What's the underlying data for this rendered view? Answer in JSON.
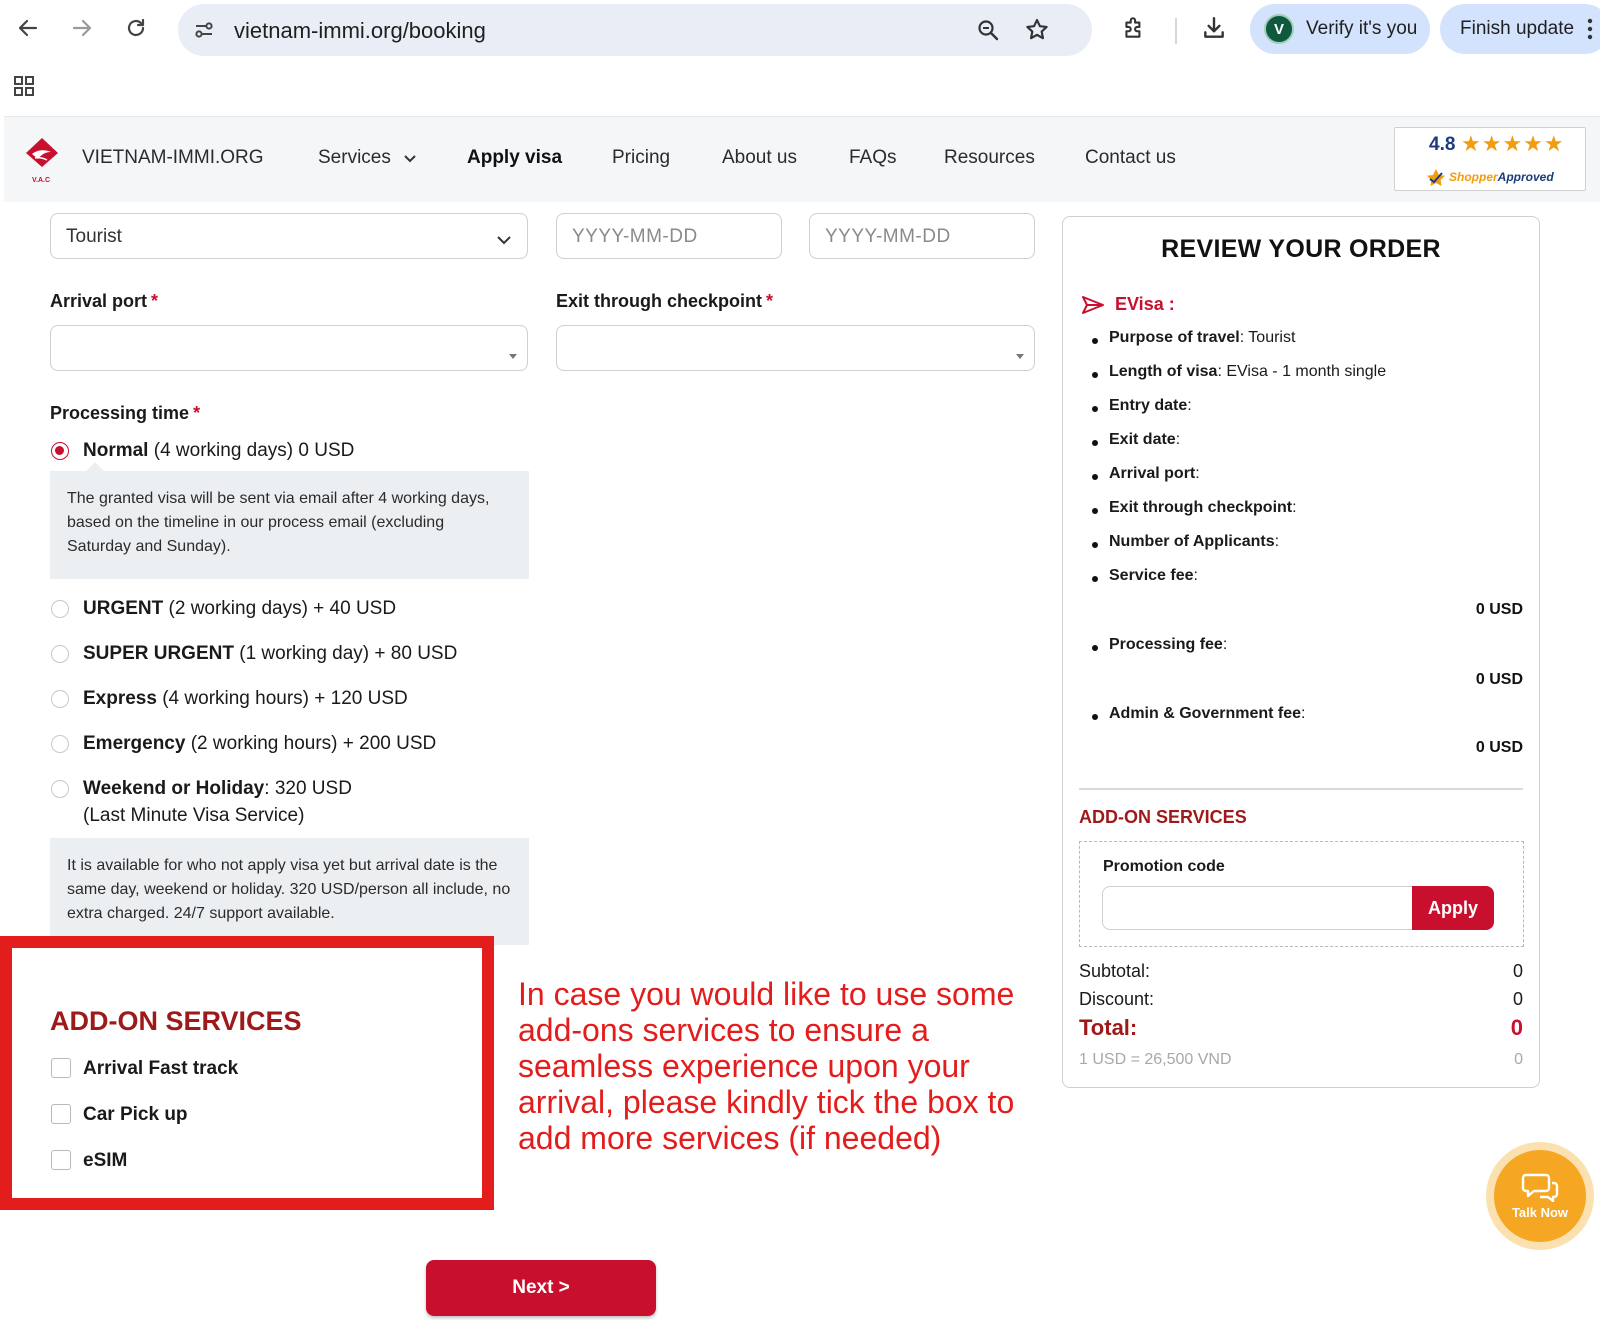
{
  "browser": {
    "url": "vietnam-immi.org/booking",
    "verify_label": "Verify it's you",
    "verify_avatar": "V",
    "update_label": "Finish update"
  },
  "header": {
    "brand": "VIETNAM-IMMI.ORG",
    "logo_caption": "V.A.C",
    "nav": [
      "Services",
      "Apply visa",
      "Pricing",
      "About us",
      "FAQs",
      "Resources",
      "Contact us"
    ],
    "rating": "4.8",
    "stars": "★★★★★",
    "shopper_prefix": "Shopper",
    "shopper_suffix": "Approved"
  },
  "form": {
    "purpose_value": "Tourist",
    "entry_placeholder": "YYYY-MM-DD",
    "exit_placeholder": "YYYY-MM-DD",
    "arrival_label": "Arrival port",
    "exit_label": "Exit through checkpoint",
    "required_mark": "*",
    "processing_label": "Processing time",
    "options": [
      {
        "name": "Normal",
        "detail": "(4 working days) 0 USD",
        "selected": true
      },
      {
        "name": "URGENT",
        "detail": "(2 working days) + 40 USD",
        "selected": false
      },
      {
        "name": "SUPER URGENT",
        "detail": "(1 working day) + 80 USD",
        "selected": false
      },
      {
        "name": "Express",
        "detail": "(4 working hours) + 120 USD",
        "selected": false
      },
      {
        "name": "Emergency",
        "detail": "(2 working hours) + 200 USD",
        "selected": false
      },
      {
        "name": "Weekend or Holiday",
        "detail": ": 320 USD",
        "selected": false
      }
    ],
    "weekend_line2": "(Last Minute Visa Service)",
    "normal_info": "The granted visa will be sent via email after 4 working days, based on the timeline in our process email (excluding Saturday and Sunday).",
    "weekend_info": "It is available for who not apply visa yet but arrival date is the same day, weekend or holiday. 320 USD/person all include, no extra charged. 24/7 support available."
  },
  "addons": {
    "title": "ADD-ON SERVICES",
    "items": [
      "Arrival Fast track",
      "Car Pick up",
      "eSIM"
    ]
  },
  "annotation": "In case you would like to use some add-ons services to ensure a seamless experience upon your arrival, please kindly tick the box to add more services (if needed)",
  "next_label": "Next >",
  "review": {
    "title": "REVIEW YOUR ORDER",
    "evisa_label": "EVisa :",
    "rows": [
      {
        "label": "Purpose of travel",
        "value": ": Tourist"
      },
      {
        "label": "Length of visa",
        "value": ": EVisa - 1 month single"
      },
      {
        "label": "Entry date",
        "value": ":"
      },
      {
        "label": "Exit date",
        "value": ":"
      },
      {
        "label": "Arrival port",
        "value": ":"
      },
      {
        "label": "Exit through checkpoint",
        "value": ":"
      },
      {
        "label": "Number of Applicants",
        "value": ":"
      },
      {
        "label": "Service fee",
        "value": ":"
      },
      {
        "label": "Processing fee",
        "value": ":"
      },
      {
        "label": "Admin & Government fee",
        "value": ":"
      }
    ],
    "service_fee": "0 USD",
    "processing_fee": "0 USD",
    "admin_fee": "0 USD",
    "addon_title": "ADD-ON SERVICES",
    "promo_label": "Promotion code",
    "apply_label": "Apply",
    "subtotal_label": "Subtotal:",
    "subtotal_value": "0",
    "discount_label": "Discount:",
    "discount_value": "0",
    "total_label": "Total:",
    "total_value": "0",
    "rate_label": "1 USD = 26,500 VND",
    "rate_value": "0"
  },
  "chat": {
    "label": "Talk Now"
  },
  "colors": {
    "brand_red": "#c8102e",
    "annotation_red": "#e31c1c",
    "chat_orange": "#f5a623"
  }
}
